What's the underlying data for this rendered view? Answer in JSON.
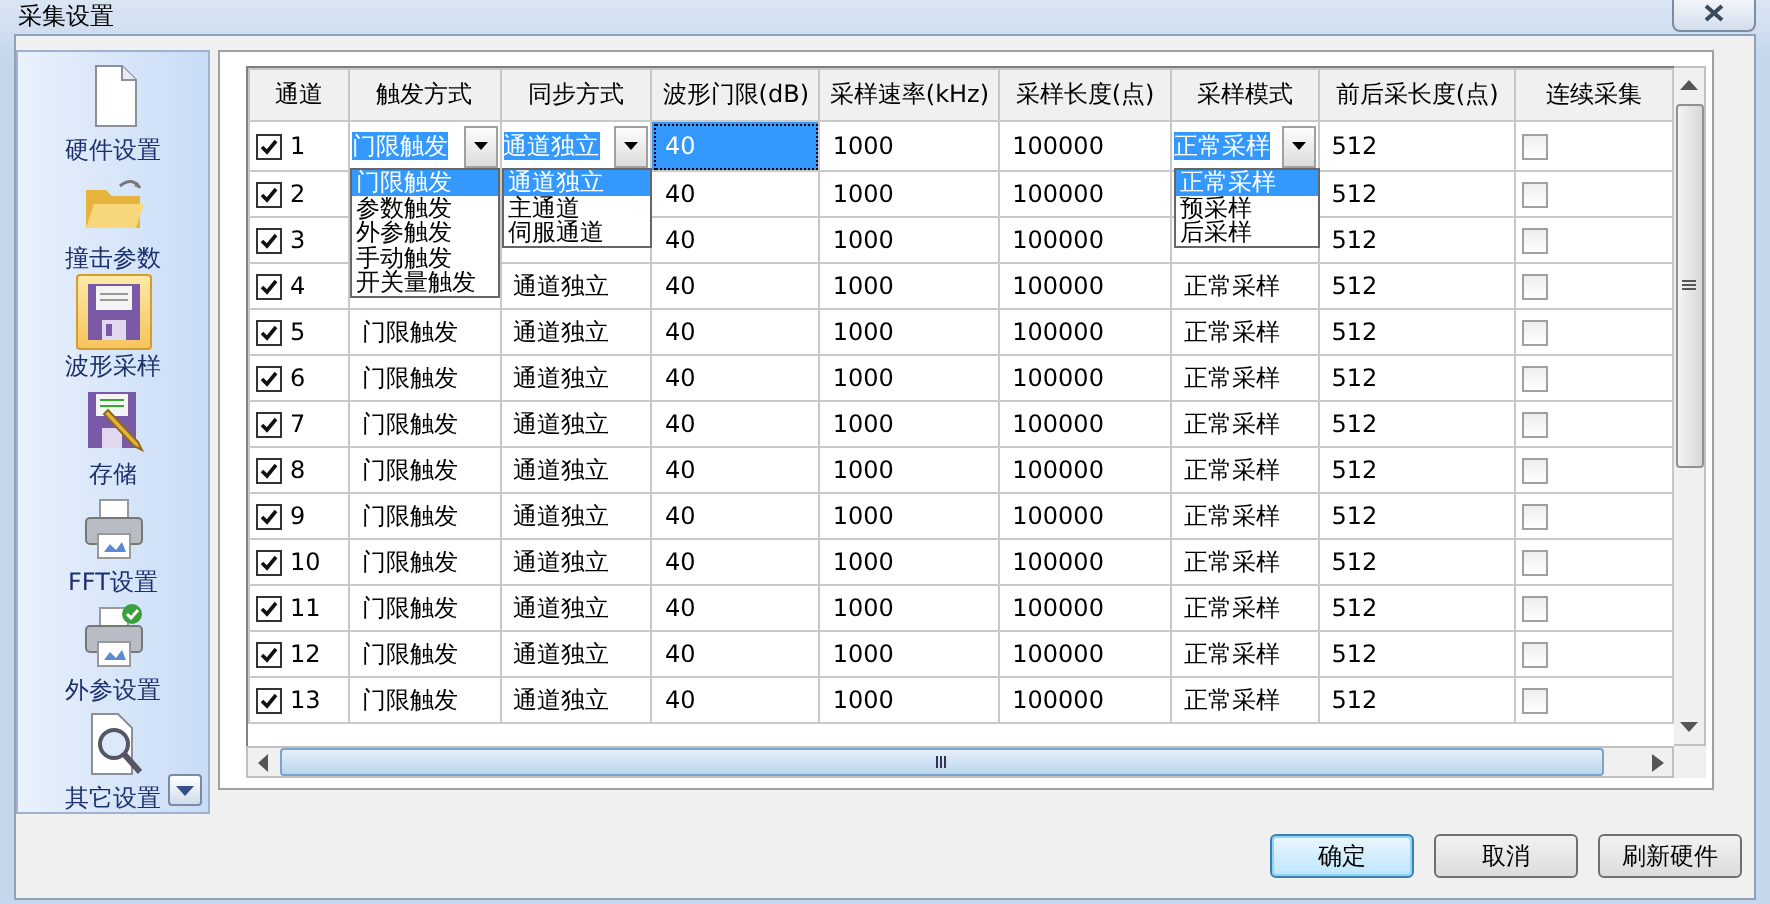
{
  "window": {
    "title": "采集设置"
  },
  "sidebar": {
    "items": [
      {
        "label": "硬件设置",
        "kind": "page",
        "selected": false
      },
      {
        "label": "撞击参数",
        "kind": "folder",
        "selected": false
      },
      {
        "label": "波形采样",
        "kind": "floppy",
        "selected": true
      },
      {
        "label": "存储",
        "kind": "floppy-pencil",
        "selected": false
      },
      {
        "label": "FFT设置",
        "kind": "printer",
        "selected": false
      },
      {
        "label": "外参设置",
        "kind": "printer-check",
        "selected": false
      },
      {
        "label": "其它设置",
        "kind": "magnifier",
        "selected": false
      }
    ]
  },
  "table": {
    "columns": [
      {
        "label": "通道",
        "kind": "check-number",
        "selected": false
      },
      {
        "label": "触发方式",
        "kind": "combo",
        "selected": false,
        "dropdown": {
          "items": [
            {
              "label": "门限触发",
              "selected": true
            },
            {
              "label": "参数触发",
              "selected": false
            },
            {
              "label": "外参触发",
              "selected": false
            },
            {
              "label": "手动触发",
              "selected": false
            },
            {
              "label": "开关量触发",
              "selected": false
            }
          ]
        }
      },
      {
        "label": "同步方式",
        "kind": "combo",
        "selected": false,
        "dropdown": {
          "items": [
            {
              "label": "通道独立",
              "selected": true
            },
            {
              "label": "主通道",
              "selected": false
            },
            {
              "label": "伺服通道",
              "selected": false
            }
          ]
        }
      },
      {
        "label": "波形门限(dB)",
        "kind": "text",
        "selected": true
      },
      {
        "label": "采样速率(kHz)",
        "kind": "text",
        "selected": false
      },
      {
        "label": "采样长度(点)",
        "kind": "text",
        "selected": false
      },
      {
        "label": "采样模式",
        "kind": "combo",
        "selected": false,
        "dropdown": {
          "items": [
            {
              "label": "正常采样",
              "selected": true
            },
            {
              "label": "预采样",
              "selected": false
            },
            {
              "label": "后采样",
              "selected": false
            }
          ]
        }
      },
      {
        "label": "前后采长度(点)",
        "kind": "text",
        "selected": false
      },
      {
        "label": "连续采集",
        "kind": "check",
        "selected": false
      }
    ],
    "rows": [
      {
        "editing": true,
        "cells": [
          {
            "text": "1",
            "checked": true
          },
          "门限触发",
          "通道独立",
          "40",
          "1000",
          "100000",
          "正常采样",
          "512",
          {
            "checked": false
          }
        ]
      },
      {
        "editing": false,
        "cells": [
          {
            "text": "2",
            "checked": true
          },
          null,
          null,
          "40",
          "1000",
          "100000",
          null,
          "512",
          {
            "checked": false
          }
        ]
      },
      {
        "editing": false,
        "cells": [
          {
            "text": "3",
            "checked": true
          },
          null,
          null,
          "40",
          "1000",
          "100000",
          null,
          "512",
          {
            "checked": false
          }
        ]
      },
      {
        "editing": false,
        "cells": [
          {
            "text": "4",
            "checked": true
          },
          null,
          "通道独立",
          "40",
          "1000",
          "100000",
          "正常采样",
          "512",
          {
            "checked": false
          }
        ]
      },
      {
        "editing": false,
        "cells": [
          {
            "text": "5",
            "checked": true
          },
          "门限触发",
          "通道独立",
          "40",
          "1000",
          "100000",
          "正常采样",
          "512",
          {
            "checked": false
          }
        ]
      },
      {
        "editing": false,
        "cells": [
          {
            "text": "6",
            "checked": true
          },
          "门限触发",
          "通道独立",
          "40",
          "1000",
          "100000",
          "正常采样",
          "512",
          {
            "checked": false
          }
        ]
      },
      {
        "editing": false,
        "cells": [
          {
            "text": "7",
            "checked": true
          },
          "门限触发",
          "通道独立",
          "40",
          "1000",
          "100000",
          "正常采样",
          "512",
          {
            "checked": false
          }
        ]
      },
      {
        "editing": false,
        "cells": [
          {
            "text": "8",
            "checked": true
          },
          "门限触发",
          "通道独立",
          "40",
          "1000",
          "100000",
          "正常采样",
          "512",
          {
            "checked": false
          }
        ]
      },
      {
        "editing": false,
        "cells": [
          {
            "text": "9",
            "checked": true
          },
          "门限触发",
          "通道独立",
          "40",
          "1000",
          "100000",
          "正常采样",
          "512",
          {
            "checked": false
          }
        ]
      },
      {
        "editing": false,
        "cells": [
          {
            "text": "10",
            "checked": true
          },
          "门限触发",
          "通道独立",
          "40",
          "1000",
          "100000",
          "正常采样",
          "512",
          {
            "checked": false
          }
        ]
      },
      {
        "editing": false,
        "cells": [
          {
            "text": "11",
            "checked": true
          },
          "门限触发",
          "通道独立",
          "40",
          "1000",
          "100000",
          "正常采样",
          "512",
          {
            "checked": false
          }
        ]
      },
      {
        "editing": false,
        "cells": [
          {
            "text": "12",
            "checked": true
          },
          "门限触发",
          "通道独立",
          "40",
          "1000",
          "100000",
          "正常采样",
          "512",
          {
            "checked": false
          }
        ]
      },
      {
        "editing": false,
        "cells": [
          {
            "text": "13",
            "checked": true
          },
          "门限触发",
          "通道独立",
          "40",
          "1000",
          "100000",
          "正常采样",
          "512",
          {
            "checked": false
          }
        ]
      }
    ]
  },
  "buttons": [
    {
      "label": "确定",
      "default": true
    },
    {
      "label": "取消",
      "default": false
    },
    {
      "label": "刷新硬件",
      "default": false
    }
  ]
}
